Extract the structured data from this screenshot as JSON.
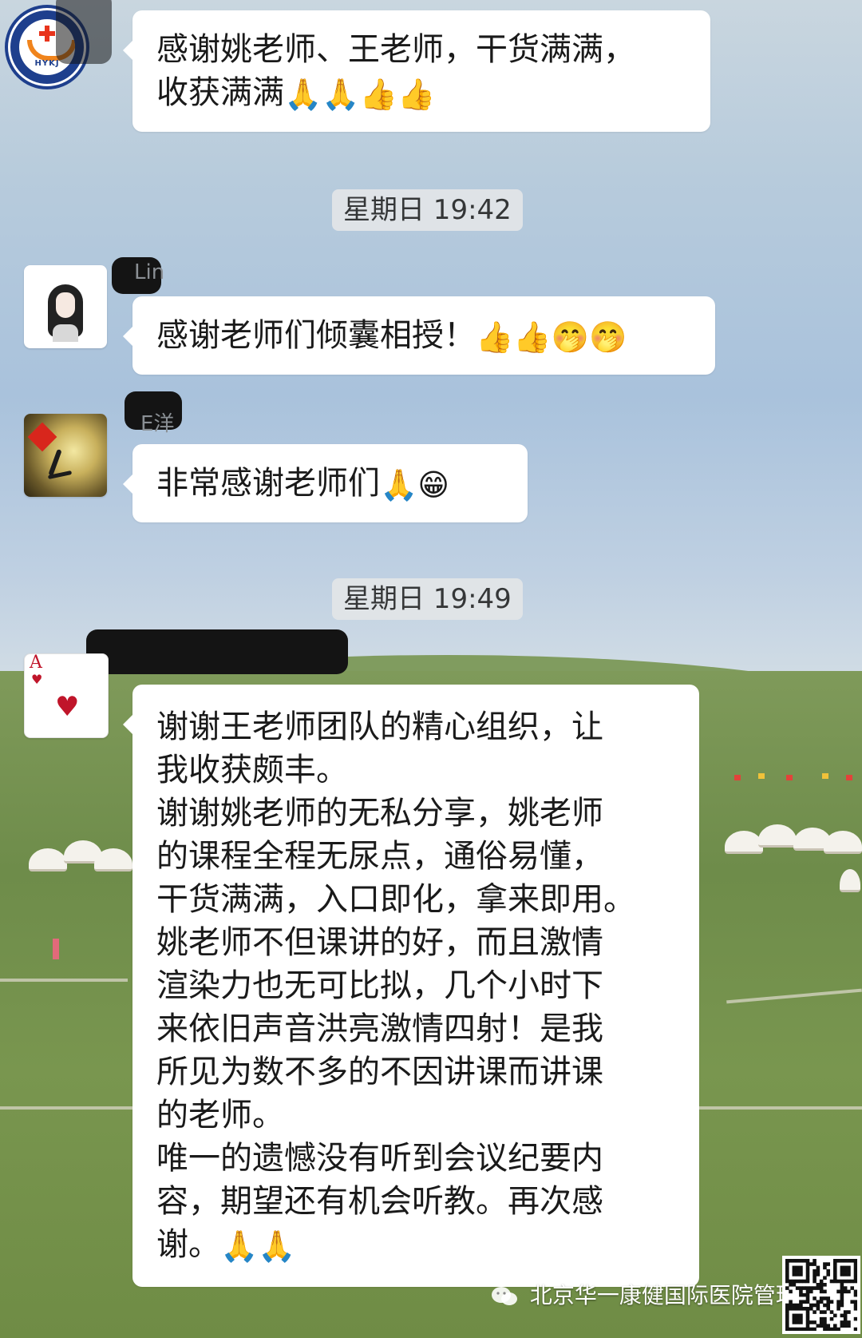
{
  "messages": [
    {
      "text": "感谢姚老师、王老师，干货满满，\n收获满满",
      "emojis": "🙏🙏👍👍"
    },
    {
      "sender_partial": "Lin",
      "text": "感谢老师们倾囊相授！",
      "emojis": "👍👍🤭🤭"
    },
    {
      "sender_partial": "E洋",
      "text": "非常感谢老师们",
      "emojis": "🙏😁"
    },
    {
      "text": "谢谢王老师团队的精心组织，让\n我收获颇丰。\n谢谢姚老师的无私分享，姚老师\n的课程全程无尿点，通俗易懂，\n干货满满，入口即化，拿来即用。\n姚老师不但课讲的好，而且激情\n渲染力也无可比拟，几个小时下\n来依旧声音洪亮激情四射！是我\n所见为数不多的不因讲课而讲课\n的老师。\n唯一的遗憾没有听到会议纪要内\n容，期望还有机会听教。再次感\n谢。",
      "emojis": "🙏🙏"
    }
  ],
  "timestamps": [
    "星期日 19:42",
    "星期日 19:49"
  ],
  "logo": {
    "text": "HYKJ"
  },
  "avatars": {
    "card_rank": "A",
    "card_suit": "♥"
  },
  "watermark": {
    "text": "北京华一康健国际医院管理"
  }
}
